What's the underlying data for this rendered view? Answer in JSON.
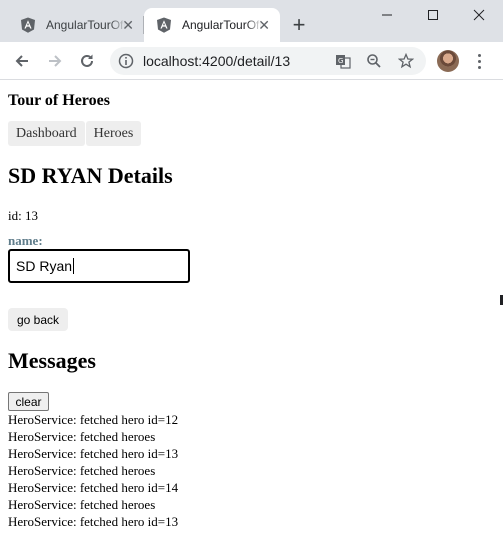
{
  "browser": {
    "tabs": [
      {
        "title": "AngularTourOfHeroes",
        "active": false
      },
      {
        "title": "AngularTourOfHeroes",
        "active": true
      }
    ],
    "tab_close_glyph": "✕",
    "new_tab_glyph": "+",
    "url": "localhost:4200/detail/13",
    "icons": [
      "angular-icon",
      "close-icon",
      "minimize-icon",
      "maximize-icon",
      "window-close-icon",
      "back-icon",
      "forward-icon",
      "reload-icon",
      "info-icon",
      "translate-icon",
      "zoom-out-icon",
      "star-icon",
      "avatar",
      "menu-icon"
    ]
  },
  "app": {
    "title": "Tour of Heroes",
    "nav": [
      {
        "label": "Dashboard"
      },
      {
        "label": "Heroes"
      }
    ]
  },
  "detail": {
    "title": "SD RYAN Details",
    "id_label": "id: ",
    "id_value": "13",
    "name_label": "name:",
    "name_value": "SD Ryan",
    "go_back_label": "go back"
  },
  "messages": {
    "title": "Messages",
    "clear_label": "clear",
    "items": [
      "HeroService: fetched hero id=12",
      "HeroService: fetched heroes",
      "HeroService: fetched hero id=13",
      "HeroService: fetched heroes",
      "HeroService: fetched hero id=14",
      "HeroService: fetched heroes",
      "HeroService: fetched hero id=13"
    ]
  },
  "colors": {
    "tabstrip": "#dee1e6",
    "nav_bg": "#eeeeee",
    "label": "#607d8b",
    "angular_red": "#dd0031"
  }
}
